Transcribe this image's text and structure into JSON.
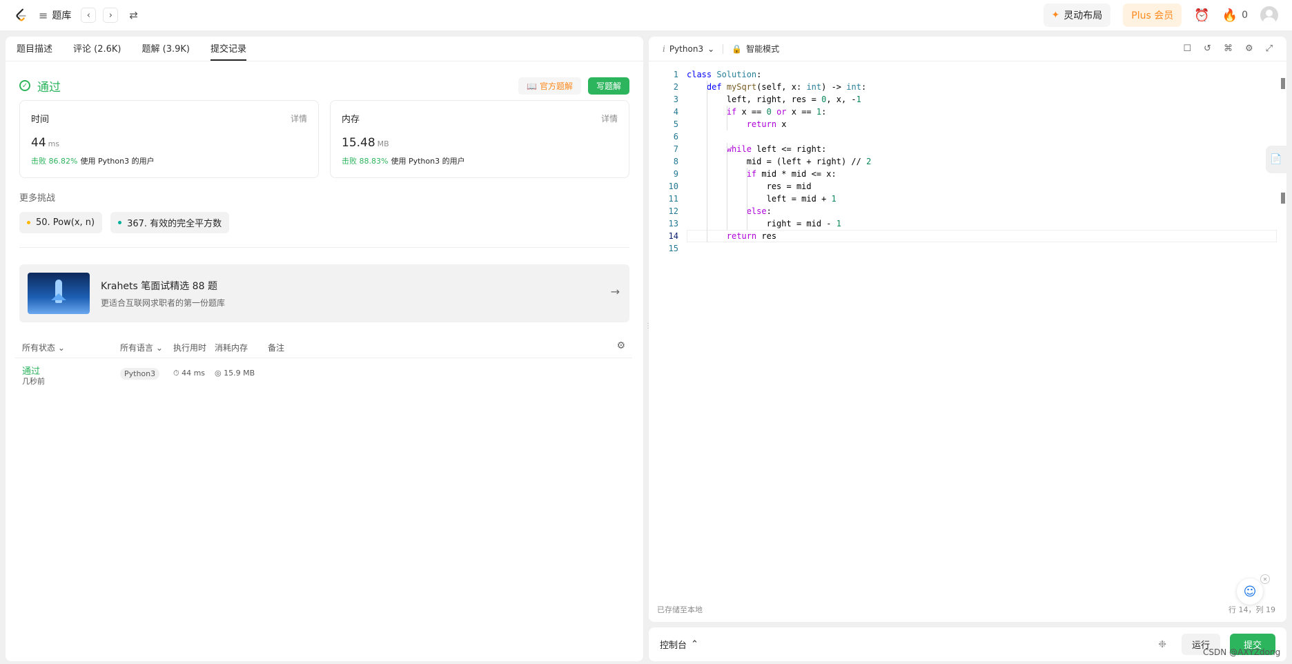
{
  "topbar": {
    "library_label": "题库",
    "layout_label": "灵动布局",
    "plus_label": "Plus 会员",
    "streak_count": "0"
  },
  "left": {
    "tabs": [
      {
        "label": "题目描述"
      },
      {
        "label": "评论 (2.6K)"
      },
      {
        "label": "题解 (3.9K)"
      },
      {
        "label": "提交记录"
      }
    ],
    "result": {
      "status": "通过",
      "official_solution": "官方题解",
      "write_solution": "写题解"
    },
    "stats": [
      {
        "label": "时间",
        "detail": "详情",
        "value": "44",
        "unit": "ms",
        "beat": "击败 86.82%",
        "beat_suffix": "使用 Python3 的用户"
      },
      {
        "label": "内存",
        "detail": "详情",
        "value": "15.48",
        "unit": "MB",
        "beat": "击败 88.83%",
        "beat_suffix": "使用 Python3 的用户"
      }
    ],
    "more_title": "更多挑战",
    "challenges": [
      {
        "label": "50. Pow(x, n)",
        "color": "#ffb800"
      },
      {
        "label": "367. 有效的完全平方数",
        "color": "#00af9b"
      }
    ],
    "promo": {
      "title": "Krahets 笔面试精选 88 题",
      "subtitle": "更适合互联网求职者的第一份题库"
    },
    "table": {
      "headers": [
        "所有状态",
        "所有语言",
        "执行用时",
        "消耗内存",
        "备注"
      ],
      "rows": [
        {
          "status": "通过",
          "time_ago": "几秒前",
          "language": "Python3",
          "runtime": "44 ms",
          "memory": "15.9 MB"
        }
      ]
    }
  },
  "editor": {
    "language": "Python3",
    "mode": "智能模式",
    "saved": "已存储至本地",
    "position": "行 14，列 19"
  },
  "code_lines": [
    "class Solution:",
    "    def mySqrt(self, x: int) -> int:",
    "        left, right, res = 0, x, -1",
    "        if x == 0 or x == 1:",
    "            return x",
    "",
    "        while left <= right:",
    "            mid = (left + right) // 2",
    "            if mid * mid <= x:",
    "                res = mid",
    "                left = mid + 1",
    "            else:",
    "                right = mid - 1",
    "        return res",
    ""
  ],
  "console": {
    "label": "控制台",
    "run": "运行",
    "submit": "提交"
  },
  "watermark": "CSDN @AXYZdong",
  "colors": {
    "accent_green": "#2db55d",
    "accent_orange": "#ff8a1f"
  }
}
